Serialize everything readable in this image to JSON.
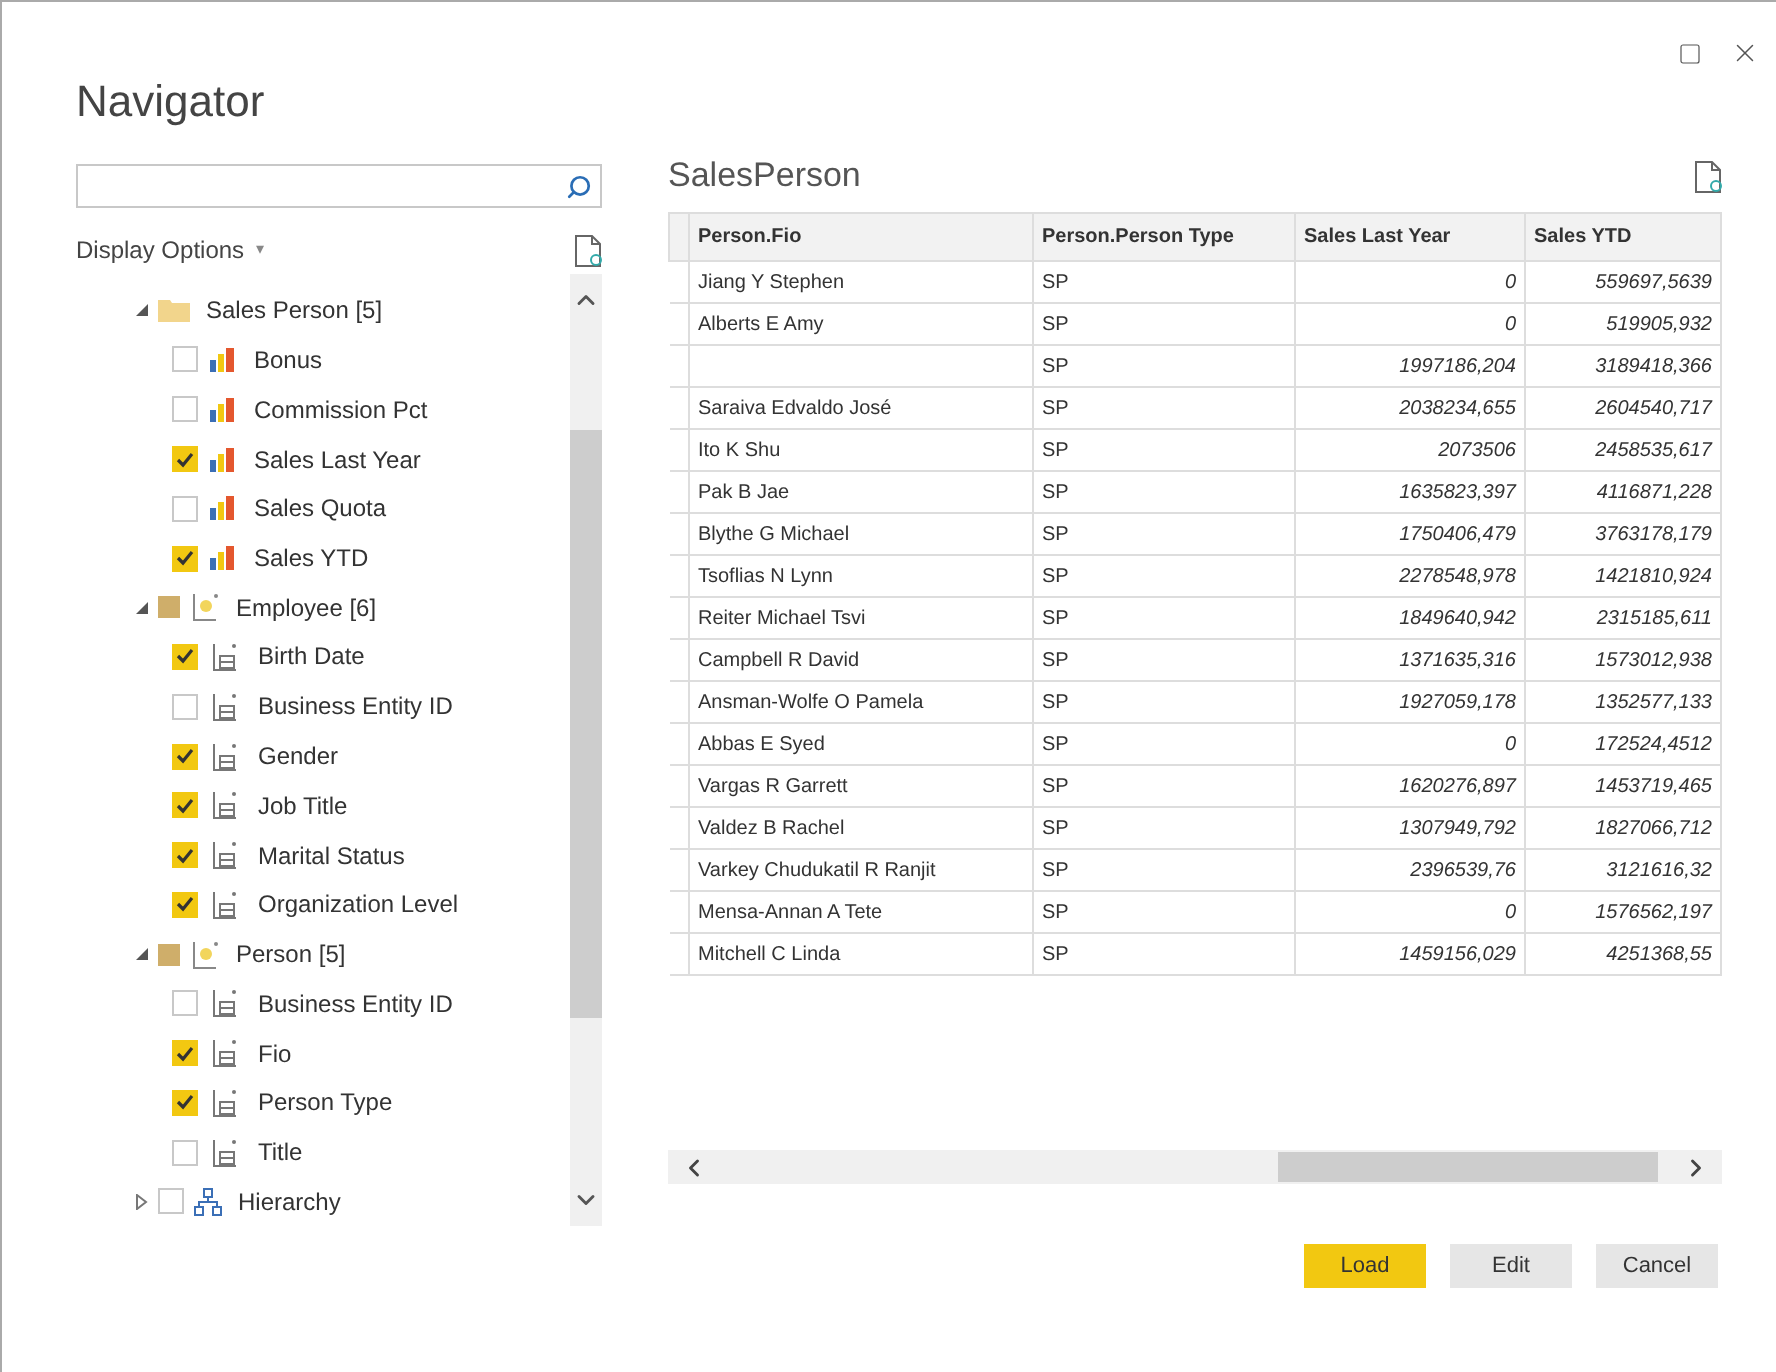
{
  "window": {
    "title": "Navigator"
  },
  "display_options": {
    "label": "Display Options",
    "caret": "▾"
  },
  "tree": [
    {
      "kind": "folder",
      "label": "Sales Person [5]",
      "expanded": true,
      "children": [
        {
          "kind": "measure",
          "label": "Bonus",
          "checked": false
        },
        {
          "kind": "measure",
          "label": "Commission Pct",
          "checked": false
        },
        {
          "kind": "measure",
          "label": "Sales Last Year",
          "checked": true
        },
        {
          "kind": "measure",
          "label": "Sales Quota",
          "checked": false
        },
        {
          "kind": "measure",
          "label": "Sales YTD",
          "checked": true
        }
      ]
    },
    {
      "kind": "table",
      "label": "Employee [6]",
      "expanded": true,
      "partial": true,
      "children": [
        {
          "kind": "column",
          "label": "Birth Date",
          "checked": true
        },
        {
          "kind": "column",
          "label": "Business Entity ID",
          "checked": false
        },
        {
          "kind": "column",
          "label": "Gender",
          "checked": true
        },
        {
          "kind": "column",
          "label": "Job Title",
          "checked": true
        },
        {
          "kind": "column",
          "label": "Marital Status",
          "checked": true
        },
        {
          "kind": "column",
          "label": "Organization Level",
          "checked": true
        }
      ]
    },
    {
      "kind": "table",
      "label": "Person [5]",
      "expanded": true,
      "partial": true,
      "children": [
        {
          "kind": "column",
          "label": "Business Entity ID",
          "checked": false
        },
        {
          "kind": "column",
          "label": "Fio",
          "checked": true
        },
        {
          "kind": "column",
          "label": "Person Type",
          "checked": true
        },
        {
          "kind": "column",
          "label": "Title",
          "checked": false
        }
      ]
    },
    {
      "kind": "hierarchy",
      "label": "Hierarchy",
      "expanded": false,
      "checked": false
    }
  ],
  "preview": {
    "title": "SalesPerson",
    "columns": [
      "Person.Fio",
      "Person.Person Type",
      "Sales Last Year",
      "Sales YTD"
    ],
    "rows": [
      [
        "Jiang Y Stephen",
        "SP",
        "0",
        "559697,5639"
      ],
      [
        "Alberts E Amy",
        "SP",
        "0",
        "519905,932"
      ],
      [
        null,
        "SP",
        "1997186,204",
        "3189418,366"
      ],
      [
        "Saraiva Edvaldo José",
        "SP",
        "2038234,655",
        "2604540,717"
      ],
      [
        "Ito K Shu",
        "SP",
        "2073506",
        "2458535,617"
      ],
      [
        "Pak B Jae",
        "SP",
        "1635823,397",
        "4116871,228"
      ],
      [
        "Blythe G Michael",
        "SP",
        "1750406,479",
        "3763178,179"
      ],
      [
        "Tsoflias N Lynn",
        "SP",
        "2278548,978",
        "1421810,924"
      ],
      [
        "Reiter Michael Tsvi",
        "SP",
        "1849640,942",
        "2315185,611"
      ],
      [
        "Campbell R David",
        "SP",
        "1371635,316",
        "1573012,938"
      ],
      [
        "Ansman-Wolfe O Pamela",
        "SP",
        "1927059,178",
        "1352577,133"
      ],
      [
        "Abbas E Syed",
        "SP",
        "0",
        "172524,4512"
      ],
      [
        "Vargas R Garrett",
        "SP",
        "1620276,897",
        "1453719,465"
      ],
      [
        "Valdez B Rachel",
        "SP",
        "1307949,792",
        "1827066,712"
      ],
      [
        "Varkey Chudukatil R Ranjit",
        "SP",
        "2396539,76",
        "3121616,32"
      ],
      [
        "Mensa-Annan A Tete",
        "SP",
        "0",
        "1576562,197"
      ],
      [
        "Mitchell C Linda",
        "SP",
        "1459156,029",
        "4251368,55"
      ]
    ]
  },
  "buttons": [
    {
      "label": "Load",
      "kind": "primary"
    },
    {
      "label": "Edit",
      "kind": "secondary"
    },
    {
      "label": "Cancel",
      "kind": "secondary"
    }
  ]
}
